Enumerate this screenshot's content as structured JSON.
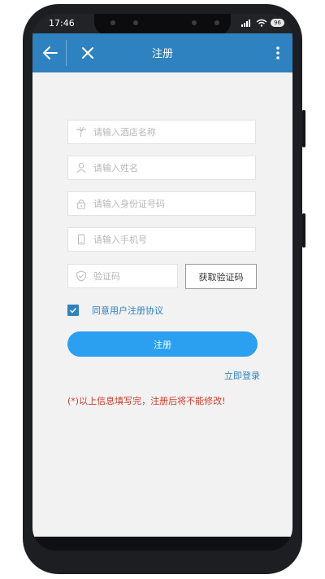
{
  "statusbar": {
    "time": "17:46",
    "battery": "96"
  },
  "appbar": {
    "title": "注册"
  },
  "form": {
    "hotel_placeholder": "请输入酒店名称",
    "name_placeholder": "请输入姓名",
    "id_placeholder": "请输入身份证号码",
    "phone_placeholder": "请输入手机号",
    "code_placeholder": "验证码",
    "get_code_label": "获取验证码",
    "agree_label": "同意用户注册协议",
    "agree_checked": true,
    "register_label": "注册",
    "login_link": "立即登录",
    "warning": "(*)以上信息填写完，注册后将不能修改!"
  },
  "colors": {
    "primary": "#2e82bf",
    "button": "#2ba0f0",
    "warning": "#d03b27",
    "background": "#f2f2f2"
  }
}
